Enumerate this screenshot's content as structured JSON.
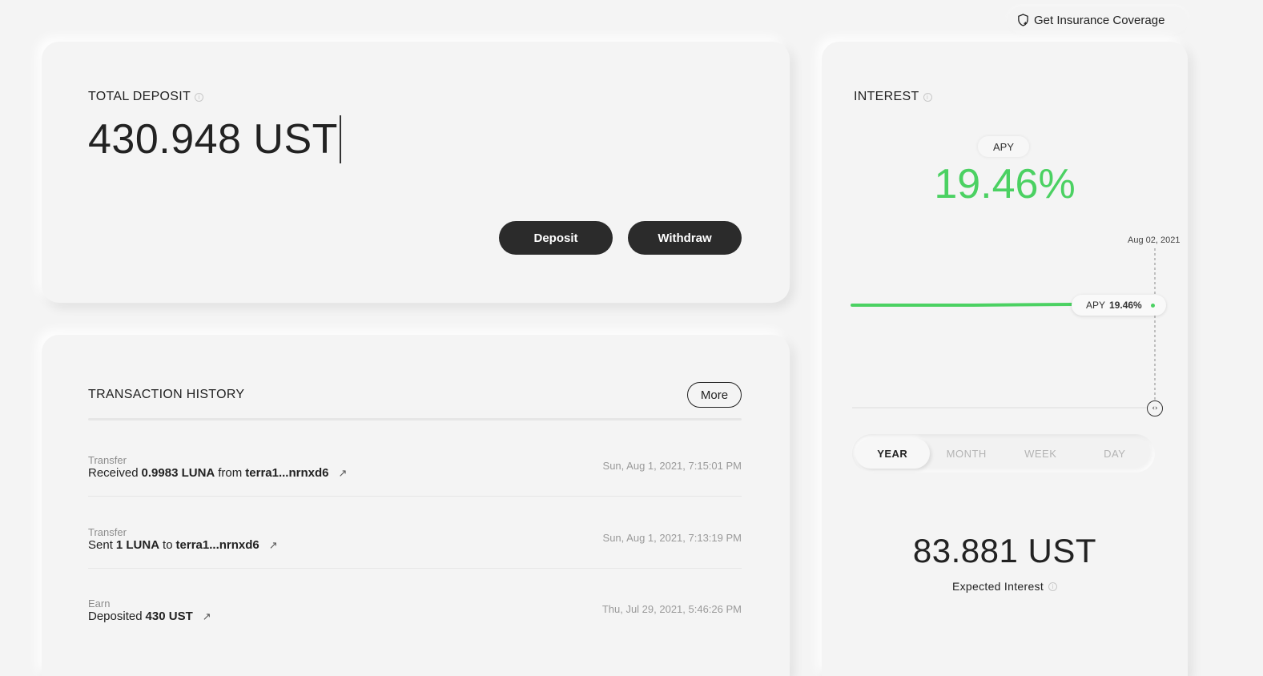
{
  "header": {
    "insurance_label": "Get Insurance Coverage",
    "insurance_icon": "shield-plus-icon"
  },
  "deposit": {
    "title": "TOTAL DEPOSIT",
    "amount": "430.948 UST",
    "deposit_label": "Deposit",
    "withdraw_label": "Withdraw"
  },
  "history": {
    "title": "TRANSACTION HISTORY",
    "more_label": "More",
    "rows": [
      {
        "type": "Transfer",
        "pre": "Received",
        "amount": "0.9983 LUNA",
        "mid": "from",
        "address": "terra1...nrnxd6",
        "time": "Sun, Aug 1, 2021, 7:15:01 PM"
      },
      {
        "type": "Transfer",
        "pre": "Sent",
        "amount": "1 LUNA",
        "mid": "to",
        "address": "terra1...nrnxd6",
        "time": "Sun, Aug 1, 2021, 7:13:19 PM"
      },
      {
        "type": "Earn",
        "pre": "Deposited",
        "amount": "430 UST",
        "mid": "",
        "address": "",
        "time": "Thu, Jul 29, 2021, 5:46:26 PM"
      }
    ]
  },
  "interest": {
    "title": "INTEREST",
    "apy_badge": "APY",
    "apy_value": "19.46%",
    "chart_date": "Aug 02, 2021",
    "tooltip_label": "APY",
    "tooltip_value": "19.46%",
    "tabs": [
      "YEAR",
      "MONTH",
      "WEEK",
      "DAY"
    ],
    "active_tab": "YEAR",
    "expected_value": "83.881 UST",
    "expected_label": "Expected Interest"
  },
  "colors": {
    "accent_green": "#4bd162",
    "button_dark": "#2b2b2b",
    "background": "#f4f4f4"
  }
}
